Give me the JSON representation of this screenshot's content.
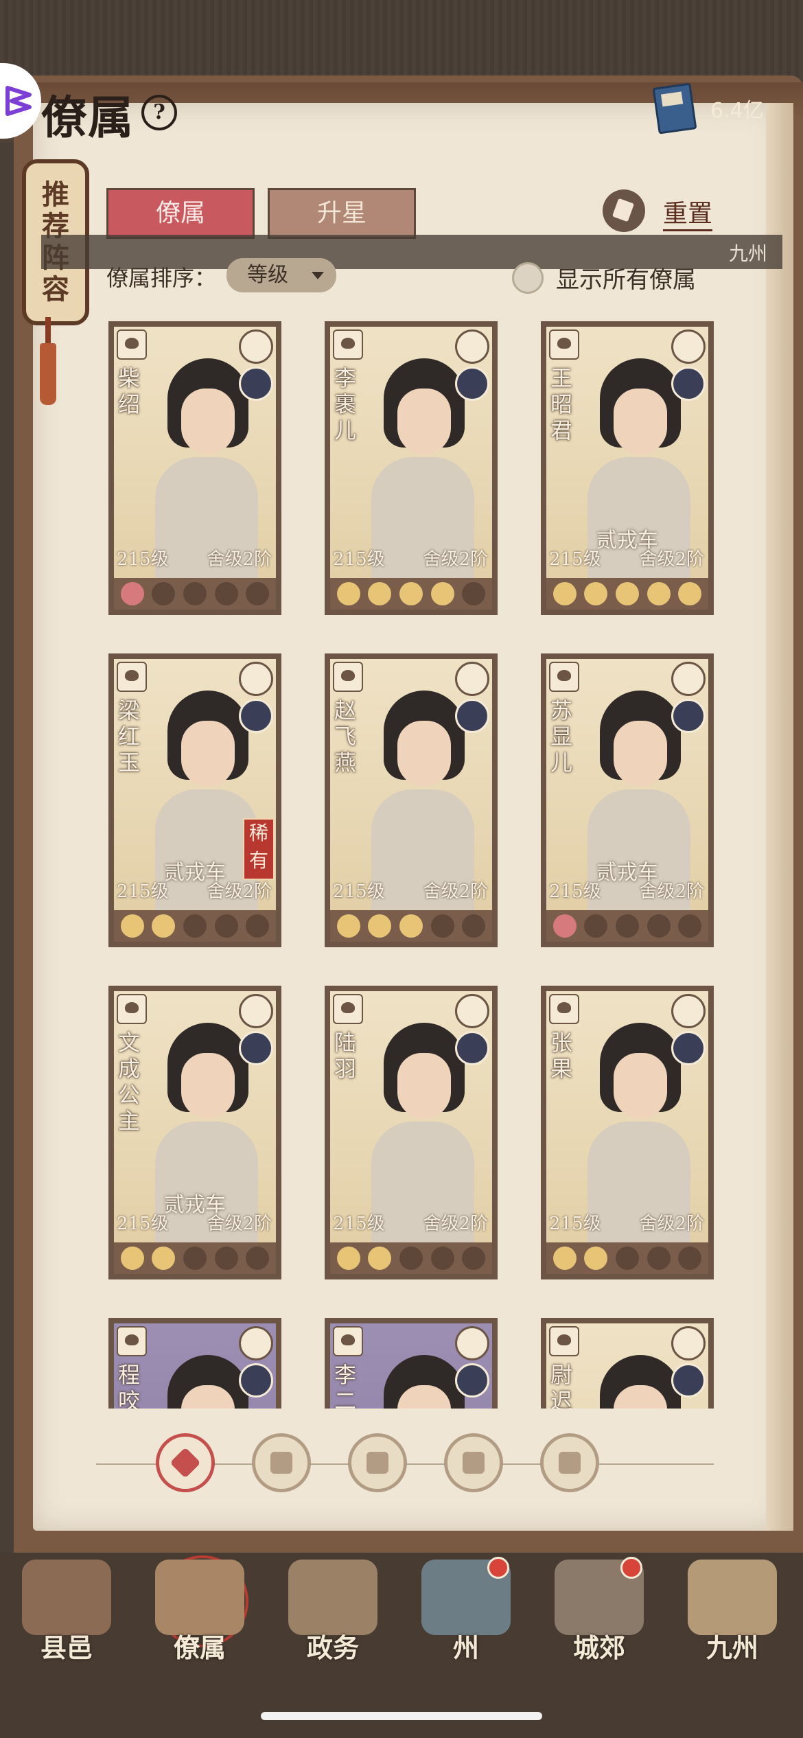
{
  "header": {
    "title": "僚属",
    "help_label": "?",
    "currency_value": "6.4亿"
  },
  "side_tag": {
    "chars": [
      "推",
      "荐",
      "阵",
      "容"
    ]
  },
  "tabs": [
    {
      "label": "僚属",
      "active": true
    },
    {
      "label": "升星",
      "active": false
    }
  ],
  "reset_label": "重置",
  "banner_text": "九州",
  "sort": {
    "label": "僚属排序：",
    "value": "等级"
  },
  "show_all_label": "显示所有僚属",
  "cards": [
    {
      "name": "柴绍",
      "subtitle": "",
      "level": "215级",
      "rank": "舍级2阶",
      "stars": 1,
      "star_color": "red",
      "rare": ""
    },
    {
      "name": "李裹儿",
      "subtitle": "",
      "level": "215级",
      "rank": "舍级2阶",
      "stars": 4,
      "star_color": "gold",
      "rare": ""
    },
    {
      "name": "王昭君",
      "subtitle": "贰戎车",
      "level": "215级",
      "rank": "舍级2阶",
      "stars": 5,
      "star_color": "gold",
      "rare": ""
    },
    {
      "name": "梁红玉",
      "subtitle": "贰戎车",
      "level": "215级",
      "rank": "舍级2阶",
      "stars": 2,
      "star_color": "gold",
      "rare": "稀有"
    },
    {
      "name": "赵飞燕",
      "subtitle": "",
      "level": "215级",
      "rank": "舍级2阶",
      "stars": 3,
      "star_color": "gold",
      "rare": ""
    },
    {
      "name": "苏显儿",
      "subtitle": "贰戎车",
      "level": "215级",
      "rank": "舍级2阶",
      "stars": 1,
      "star_color": "red",
      "rare": ""
    },
    {
      "name": "文成公主",
      "subtitle": "贰戎车",
      "level": "215级",
      "rank": "舍级2阶",
      "stars": 2,
      "star_color": "gold",
      "rare": ""
    },
    {
      "name": "陆羽",
      "subtitle": "",
      "level": "215级",
      "rank": "舍级2阶",
      "stars": 2,
      "star_color": "gold",
      "rare": ""
    },
    {
      "name": "张果",
      "subtitle": "",
      "level": "215级",
      "rank": "舍级2阶",
      "stars": 2,
      "star_color": "gold",
      "rare": ""
    },
    {
      "name": "程咬",
      "subtitle": "",
      "level": "",
      "rank": "",
      "stars": 0,
      "star_color": "gold",
      "rare": "",
      "purple": true
    },
    {
      "name": "李二",
      "subtitle": "",
      "level": "",
      "rank": "",
      "stars": 0,
      "star_color": "gold",
      "rare": "",
      "purple": true
    },
    {
      "name": "尉迟",
      "subtitle": "",
      "level": "",
      "rank": "",
      "stars": 0,
      "star_color": "gold",
      "rare": ""
    }
  ],
  "filters": [
    "all-filter-icon",
    "helmet-filter-icon",
    "gourd-filter-icon",
    "fan-filter-icon",
    "mount-filter-icon"
  ],
  "bottom_nav": [
    {
      "label": "县邑",
      "icon": "gate-icon",
      "badge": false,
      "active": false
    },
    {
      "label": "僚属",
      "icon": "scrolls-icon",
      "badge": false,
      "active": true
    },
    {
      "label": "政务",
      "icon": "documents-icon",
      "badge": false,
      "active": false
    },
    {
      "label": "州",
      "icon": "palace-icon",
      "badge": true,
      "active": false
    },
    {
      "label": "城郊",
      "icon": "outskirts-icon",
      "badge": true,
      "active": false
    },
    {
      "label": "九州",
      "icon": "map-scroll-icon",
      "badge": false,
      "active": false
    }
  ]
}
